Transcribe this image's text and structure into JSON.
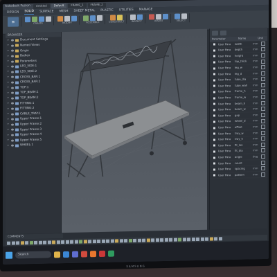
{
  "window": {
    "title": "Autodesk Fusion",
    "doc_tabs": [
      "Untitled",
      "Default",
      "FRAME_1",
      "FRAME_2"
    ]
  },
  "menu": {
    "tabs": [
      "DESIGN",
      "SOLID",
      "SURFACE",
      "MESH",
      "SHEET METAL",
      "PLASTIC",
      "UTILITIES",
      "MANAGE"
    ],
    "active": "SOLID"
  },
  "ribbon": {
    "groups": [
      {
        "label": "CREATE",
        "icons": [
          "b",
          "g",
          "b",
          "w"
        ]
      },
      {
        "label": "MODIFY",
        "icons": [
          "o",
          "w",
          "b"
        ]
      },
      {
        "label": "ASSEMBLE",
        "icons": [
          "g",
          "b",
          "w"
        ]
      },
      {
        "label": "CONSTRUCT",
        "icons": [
          "o",
          "y"
        ]
      },
      {
        "label": "INSPECT",
        "icons": [
          "w",
          "b"
        ]
      },
      {
        "label": "INSERT",
        "icons": [
          "r",
          "w",
          "b"
        ]
      },
      {
        "label": "SELECT",
        "icons": [
          "b",
          "w"
        ]
      }
    ]
  },
  "browser": {
    "title": "BROWSER",
    "items": [
      {
        "label": "Document Settings",
        "icon": "folder"
      },
      {
        "label": "Named Views",
        "icon": "folder"
      },
      {
        "label": "Origin",
        "icon": "folder"
      },
      {
        "label": "Bodies",
        "icon": "folder"
      },
      {
        "label": "Parameters",
        "icon": "folder"
      },
      {
        "label": "LEG_SIDE:1",
        "icon": "component"
      },
      {
        "label": "LEG_SIDE:2",
        "icon": "component"
      },
      {
        "label": "CROSS_BAR:1",
        "icon": "component"
      },
      {
        "label": "CROSS_BAR:2",
        "icon": "component"
      },
      {
        "label": "TOP:1",
        "icon": "component"
      },
      {
        "label": "TOP_BEAM:1",
        "icon": "component"
      },
      {
        "label": "TOP_BEAM:2",
        "icon": "component"
      },
      {
        "label": "FITTING:1",
        "icon": "component"
      },
      {
        "label": "FITTING:2",
        "icon": "component"
      },
      {
        "label": "CABLE_TRAY:1",
        "icon": "component"
      },
      {
        "label": "Upper Frame:1",
        "icon": "component"
      },
      {
        "label": "Upper Frame:2",
        "icon": "component"
      },
      {
        "label": "Upper Frame:3",
        "icon": "component"
      },
      {
        "label": "Upper Frame:4",
        "icon": "component"
      },
      {
        "label": "Upper Frame:5",
        "icon": "component"
      },
      {
        "label": "WHEEL:1",
        "icon": "component"
      }
    ]
  },
  "parameters": {
    "columns": [
      "Parameter",
      "Name",
      "Unit"
    ],
    "rows": [
      {
        "param": "User Para",
        "name": "width",
        "unit": "mm"
      },
      {
        "param": "User Para",
        "name": "depth",
        "unit": "mm"
      },
      {
        "param": "User Para",
        "name": "height",
        "unit": "mm"
      },
      {
        "param": "User Para",
        "name": "top_thick",
        "unit": "mm"
      },
      {
        "param": "User Para",
        "name": "leg_w",
        "unit": "mm"
      },
      {
        "param": "User Para",
        "name": "leg_d",
        "unit": "mm"
      },
      {
        "param": "User Para",
        "name": "tube_dia",
        "unit": "mm"
      },
      {
        "param": "User Para",
        "name": "tube_wall",
        "unit": "mm"
      },
      {
        "param": "User Para",
        "name": "frame_h",
        "unit": "mm"
      },
      {
        "param": "User Para",
        "name": "frame_w",
        "unit": "mm"
      },
      {
        "param": "User Para",
        "name": "beam_h",
        "unit": "mm"
      },
      {
        "param": "User Para",
        "name": "beam_w",
        "unit": "mm"
      },
      {
        "param": "User Para",
        "name": "gap",
        "unit": "mm"
      },
      {
        "param": "User Para",
        "name": "wheel_d",
        "unit": "mm"
      },
      {
        "param": "User Para",
        "name": "offset",
        "unit": "mm"
      },
      {
        "param": "User Para",
        "name": "tray_w",
        "unit": "mm"
      },
      {
        "param": "User Para",
        "name": "tray_h",
        "unit": "mm"
      },
      {
        "param": "User Para",
        "name": "fit_len",
        "unit": "mm"
      },
      {
        "param": "User Para",
        "name": "fit_dia",
        "unit": "mm"
      },
      {
        "param": "User Para",
        "name": "angle",
        "unit": "deg"
      },
      {
        "param": "User Para",
        "name": "count",
        "unit": ""
      },
      {
        "param": "User Para",
        "name": "spacing",
        "unit": "mm"
      },
      {
        "param": "User Para",
        "name": "pattern",
        "unit": "mm"
      }
    ]
  },
  "comments": {
    "label": "COMMENTS"
  },
  "taskbar": {
    "search_label": "Search"
  },
  "monitor_brand": "SAMSUNG"
}
